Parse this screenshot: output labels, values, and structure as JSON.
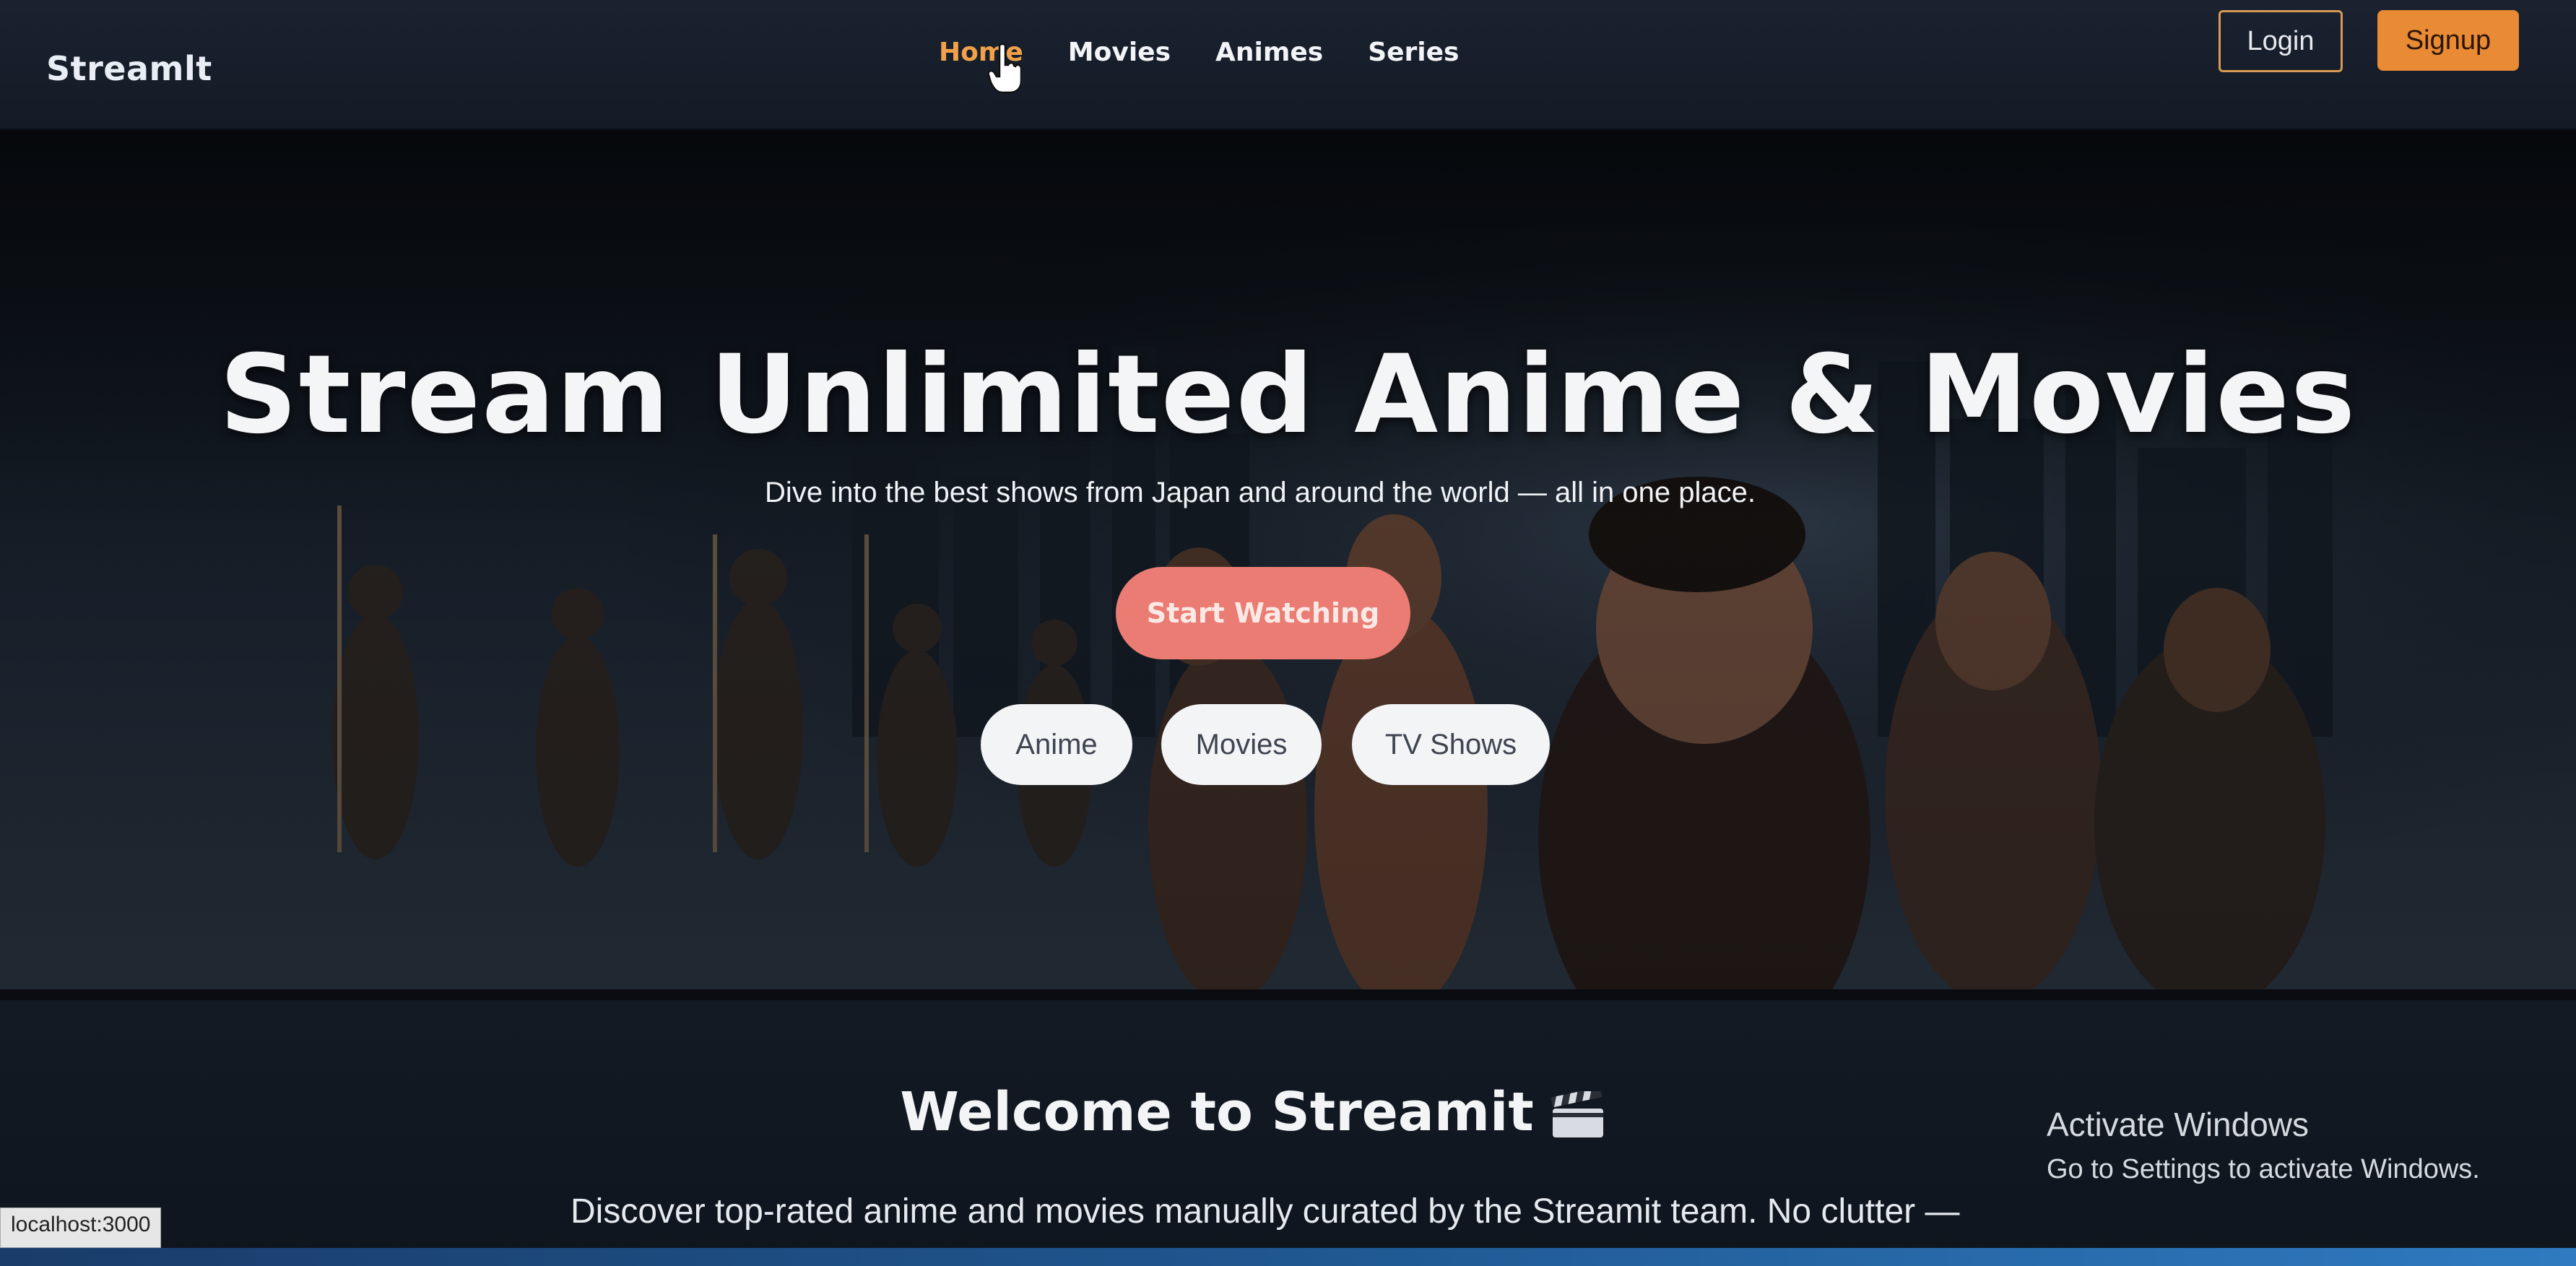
{
  "navbar": {
    "brand": "Streamlt",
    "links": [
      {
        "label": "Home",
        "active": true
      },
      {
        "label": "Movies",
        "active": false
      },
      {
        "label": "Animes",
        "active": false
      },
      {
        "label": "Series",
        "active": false
      }
    ],
    "login_label": "Login",
    "signup_label": "Signup"
  },
  "hero": {
    "title": "Stream Unlimited Anime & Movies",
    "subtitle": "Dive into the best shows from Japan and around the world — all in one place.",
    "cta_label": "Start Watching",
    "chips": [
      "Anime",
      "Movies",
      "TV Shows"
    ]
  },
  "welcome": {
    "title": "Welcome to Streamit",
    "text": "Discover top-rated anime and movies manually curated by the Streamit team. No clutter —"
  },
  "watermark": {
    "title": "Activate Windows",
    "subtitle": "Go to Settings to activate Windows."
  },
  "status_url": "localhost:3000",
  "colors": {
    "accent": "#f0a14a",
    "signup": "#e98a34",
    "cta": "#ea7c73"
  }
}
